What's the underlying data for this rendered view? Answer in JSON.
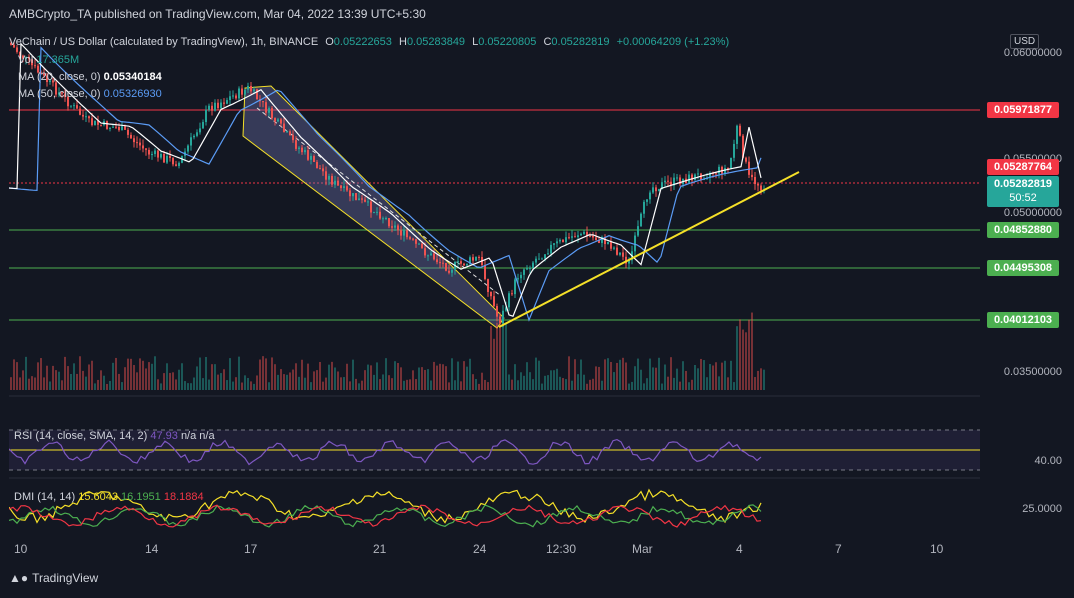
{
  "header": {
    "publish_line": "AMBCrypto_TA published on TradingView.com, Mar 04, 2022 13:39 UTC+5:30"
  },
  "legend": {
    "symbol": "VeChain / US Dollar (calculated by TradingView), 1h, BINANCE",
    "o_label": "O",
    "o_value": "0.05222653",
    "h_label": "H",
    "h_value": "0.05283849",
    "l_label": "L",
    "l_value": "0.05220805",
    "c_label": "C",
    "c_value": "0.05282819",
    "change": "+0.00064209 (+1.23%)",
    "vol_label": "Vol",
    "vol_value": "17.365M",
    "ma20_label": "MA (20, close, 0)",
    "ma20_value": "0.05340184",
    "ma50_label": "MA (50, close, 0)",
    "ma50_value": "0.05326930"
  },
  "price_axis": {
    "currency": "USD",
    "ticks": [
      "0.06000000",
      "0.05500000",
      "0.05000000",
      "0.03500000"
    ],
    "levels": [
      {
        "value": "0.05971877",
        "color": "#f23645"
      },
      {
        "value": "0.05287764",
        "color": "#f23645"
      },
      {
        "value": "0.04852880",
        "color": "#4caf50"
      },
      {
        "value": "0.04495308",
        "color": "#4caf50"
      },
      {
        "value": "0.04012103",
        "color": "#4caf50"
      }
    ],
    "current_price": "0.05282819",
    "countdown": "50:52",
    "current_color": "#26a69a"
  },
  "rsi": {
    "label": "RSI (14, close, SMA, 14, 2)",
    "value": "47.93",
    "na1": "n/a",
    "na2": "n/a",
    "axis": "40.00"
  },
  "dmi": {
    "label": "DMI (14, 14)",
    "v1": "15.6043",
    "v2": "16.1951",
    "v3": "18.1884",
    "axis": "25.0000"
  },
  "time_axis": [
    "10",
    "14",
    "17",
    "21",
    "24",
    "12:30",
    "Mar",
    "4",
    "7",
    "10"
  ],
  "footer": {
    "brand": "TradingView"
  },
  "colors": {
    "up": "#26a69a",
    "down": "#ef5350",
    "ma20": "#ffffff",
    "ma50": "#5b9cf6",
    "trend": "#f5e028",
    "rsi": "#7e57c2"
  }
}
